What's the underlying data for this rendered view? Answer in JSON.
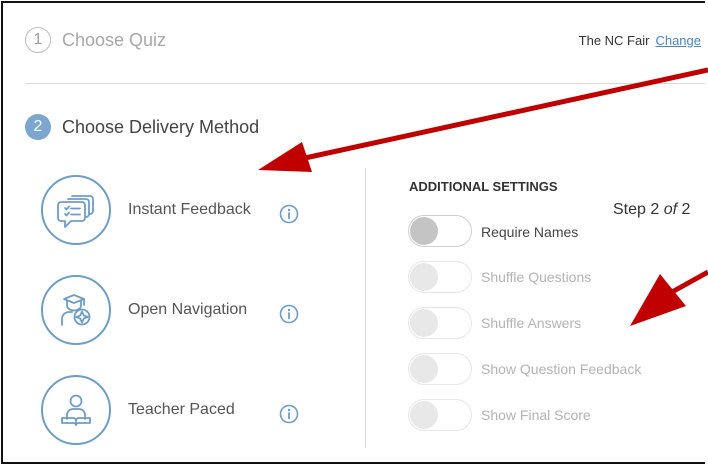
{
  "steps": [
    {
      "number": "1",
      "label": "Choose Quiz"
    },
    {
      "number": "2",
      "label": "Choose Delivery Method"
    }
  ],
  "quiz": {
    "name": "The NC Fair",
    "change_label": "Change"
  },
  "methods": [
    {
      "label": "Instant Feedback",
      "icon": "chat-bubbles-icon"
    },
    {
      "label": "Open Navigation",
      "icon": "graduate-compass-icon"
    },
    {
      "label": "Teacher Paced",
      "icon": "teacher-book-icon"
    }
  ],
  "settings": {
    "title": "ADDITIONAL SETTINGS",
    "items": [
      {
        "label": "Require Names",
        "enabled": true
      },
      {
        "label": "Shuffle Questions",
        "enabled": false
      },
      {
        "label": "Shuffle Answers",
        "enabled": false
      },
      {
        "label": "Show Question Feedback",
        "enabled": false
      },
      {
        "label": "Show Final Score",
        "enabled": false
      }
    ]
  },
  "step_indicator": {
    "prefix": "Step 2 ",
    "of": "of",
    "suffix": " 2"
  },
  "colors": {
    "accent": "#6f9dc6",
    "arrow": "#c00000",
    "link": "#4a86c8"
  }
}
